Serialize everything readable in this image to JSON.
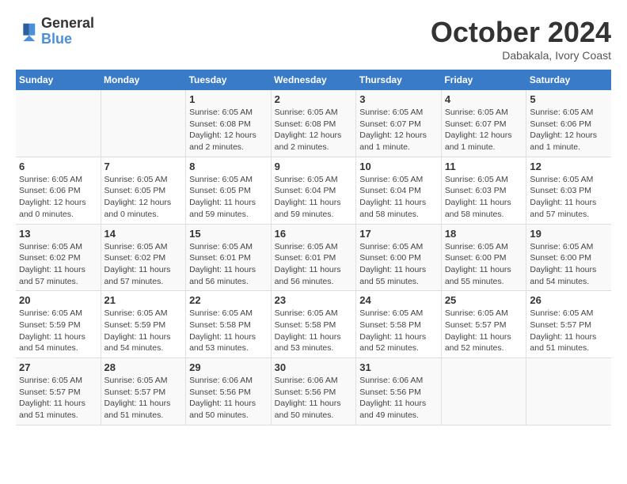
{
  "header": {
    "logo_line1": "General",
    "logo_line2": "Blue",
    "month": "October 2024",
    "location": "Dabakala, Ivory Coast"
  },
  "weekdays": [
    "Sunday",
    "Monday",
    "Tuesday",
    "Wednesday",
    "Thursday",
    "Friday",
    "Saturday"
  ],
  "weeks": [
    [
      {
        "day": "",
        "info": ""
      },
      {
        "day": "",
        "info": ""
      },
      {
        "day": "1",
        "info": "Sunrise: 6:05 AM\nSunset: 6:08 PM\nDaylight: 12 hours\nand 2 minutes."
      },
      {
        "day": "2",
        "info": "Sunrise: 6:05 AM\nSunset: 6:08 PM\nDaylight: 12 hours\nand 2 minutes."
      },
      {
        "day": "3",
        "info": "Sunrise: 6:05 AM\nSunset: 6:07 PM\nDaylight: 12 hours\nand 1 minute."
      },
      {
        "day": "4",
        "info": "Sunrise: 6:05 AM\nSunset: 6:07 PM\nDaylight: 12 hours\nand 1 minute."
      },
      {
        "day": "5",
        "info": "Sunrise: 6:05 AM\nSunset: 6:06 PM\nDaylight: 12 hours\nand 1 minute."
      }
    ],
    [
      {
        "day": "6",
        "info": "Sunrise: 6:05 AM\nSunset: 6:06 PM\nDaylight: 12 hours\nand 0 minutes."
      },
      {
        "day": "7",
        "info": "Sunrise: 6:05 AM\nSunset: 6:05 PM\nDaylight: 12 hours\nand 0 minutes."
      },
      {
        "day": "8",
        "info": "Sunrise: 6:05 AM\nSunset: 6:05 PM\nDaylight: 11 hours\nand 59 minutes."
      },
      {
        "day": "9",
        "info": "Sunrise: 6:05 AM\nSunset: 6:04 PM\nDaylight: 11 hours\nand 59 minutes."
      },
      {
        "day": "10",
        "info": "Sunrise: 6:05 AM\nSunset: 6:04 PM\nDaylight: 11 hours\nand 58 minutes."
      },
      {
        "day": "11",
        "info": "Sunrise: 6:05 AM\nSunset: 6:03 PM\nDaylight: 11 hours\nand 58 minutes."
      },
      {
        "day": "12",
        "info": "Sunrise: 6:05 AM\nSunset: 6:03 PM\nDaylight: 11 hours\nand 57 minutes."
      }
    ],
    [
      {
        "day": "13",
        "info": "Sunrise: 6:05 AM\nSunset: 6:02 PM\nDaylight: 11 hours\nand 57 minutes."
      },
      {
        "day": "14",
        "info": "Sunrise: 6:05 AM\nSunset: 6:02 PM\nDaylight: 11 hours\nand 57 minutes."
      },
      {
        "day": "15",
        "info": "Sunrise: 6:05 AM\nSunset: 6:01 PM\nDaylight: 11 hours\nand 56 minutes."
      },
      {
        "day": "16",
        "info": "Sunrise: 6:05 AM\nSunset: 6:01 PM\nDaylight: 11 hours\nand 56 minutes."
      },
      {
        "day": "17",
        "info": "Sunrise: 6:05 AM\nSunset: 6:00 PM\nDaylight: 11 hours\nand 55 minutes."
      },
      {
        "day": "18",
        "info": "Sunrise: 6:05 AM\nSunset: 6:00 PM\nDaylight: 11 hours\nand 55 minutes."
      },
      {
        "day": "19",
        "info": "Sunrise: 6:05 AM\nSunset: 6:00 PM\nDaylight: 11 hours\nand 54 minutes."
      }
    ],
    [
      {
        "day": "20",
        "info": "Sunrise: 6:05 AM\nSunset: 5:59 PM\nDaylight: 11 hours\nand 54 minutes."
      },
      {
        "day": "21",
        "info": "Sunrise: 6:05 AM\nSunset: 5:59 PM\nDaylight: 11 hours\nand 54 minutes."
      },
      {
        "day": "22",
        "info": "Sunrise: 6:05 AM\nSunset: 5:58 PM\nDaylight: 11 hours\nand 53 minutes."
      },
      {
        "day": "23",
        "info": "Sunrise: 6:05 AM\nSunset: 5:58 PM\nDaylight: 11 hours\nand 53 minutes."
      },
      {
        "day": "24",
        "info": "Sunrise: 6:05 AM\nSunset: 5:58 PM\nDaylight: 11 hours\nand 52 minutes."
      },
      {
        "day": "25",
        "info": "Sunrise: 6:05 AM\nSunset: 5:57 PM\nDaylight: 11 hours\nand 52 minutes."
      },
      {
        "day": "26",
        "info": "Sunrise: 6:05 AM\nSunset: 5:57 PM\nDaylight: 11 hours\nand 51 minutes."
      }
    ],
    [
      {
        "day": "27",
        "info": "Sunrise: 6:05 AM\nSunset: 5:57 PM\nDaylight: 11 hours\nand 51 minutes."
      },
      {
        "day": "28",
        "info": "Sunrise: 6:05 AM\nSunset: 5:57 PM\nDaylight: 11 hours\nand 51 minutes."
      },
      {
        "day": "29",
        "info": "Sunrise: 6:06 AM\nSunset: 5:56 PM\nDaylight: 11 hours\nand 50 minutes."
      },
      {
        "day": "30",
        "info": "Sunrise: 6:06 AM\nSunset: 5:56 PM\nDaylight: 11 hours\nand 50 minutes."
      },
      {
        "day": "31",
        "info": "Sunrise: 6:06 AM\nSunset: 5:56 PM\nDaylight: 11 hours\nand 49 minutes."
      },
      {
        "day": "",
        "info": ""
      },
      {
        "day": "",
        "info": ""
      }
    ]
  ]
}
